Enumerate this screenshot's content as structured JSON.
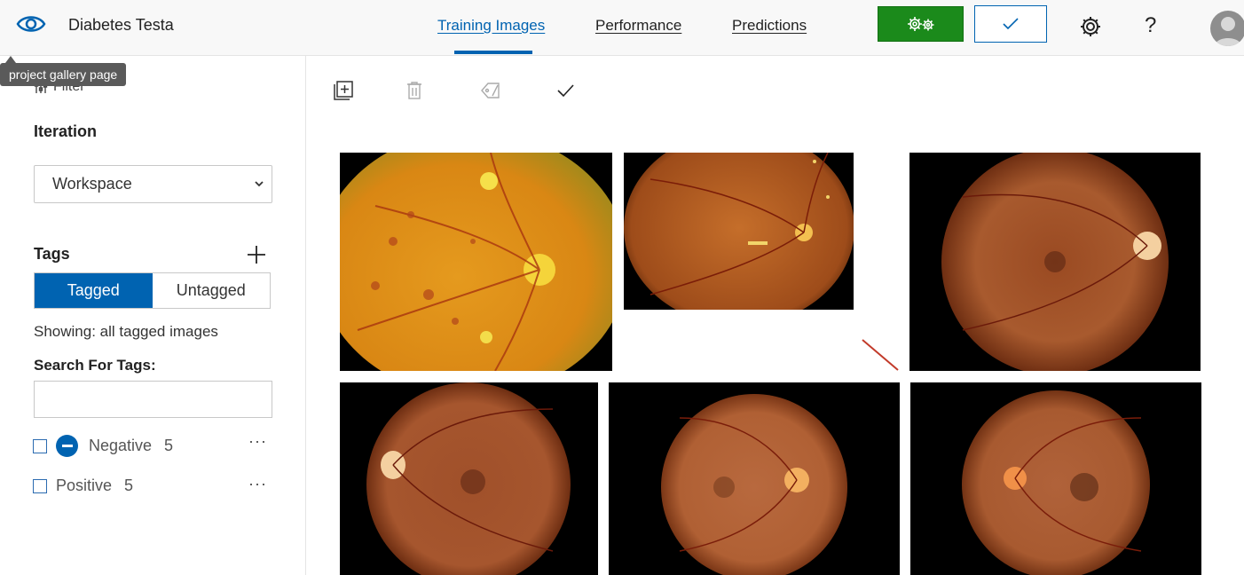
{
  "header": {
    "app_title": "Diabetes Testa",
    "nav": [
      {
        "label": "Training Images",
        "active": true
      },
      {
        "label": "Performance",
        "active": false
      },
      {
        "label": "Predictions",
        "active": false
      }
    ],
    "train_icon": "gears-icon",
    "quick_test_icon": "checkmark-icon",
    "settings_icon": "gear-icon",
    "help_label": "?",
    "avatar_icon": "user-avatar-icon"
  },
  "tooltip": {
    "text": "project gallery page"
  },
  "sidebar": {
    "filter_label": "Filter",
    "iteration_label": "Iteration",
    "iteration_value": "Workspace",
    "tags_label": "Tags",
    "segments": {
      "tagged": "Tagged",
      "untagged": "Untagged"
    },
    "showing_text": "Showing: all tagged images",
    "search_label": "Search For Tags:",
    "search_value": "",
    "tags": [
      {
        "name": "Negative",
        "count": "5",
        "more": "···"
      },
      {
        "name": "Positive",
        "count": "5",
        "more": "···"
      }
    ]
  },
  "toolbar": {
    "icons": [
      "add-images-icon",
      "delete-icon",
      "tag-icon",
      "select-check-icon"
    ]
  },
  "colors": {
    "accent": "#0063b1",
    "train_green": "#1b8a1b"
  },
  "gallery": {
    "images": [
      {
        "name": "fundus-image-1"
      },
      {
        "name": "fundus-image-2"
      },
      {
        "name": "fundus-image-3"
      },
      {
        "name": "fundus-image-4"
      },
      {
        "name": "fundus-image-5"
      },
      {
        "name": "fundus-image-6"
      }
    ]
  }
}
